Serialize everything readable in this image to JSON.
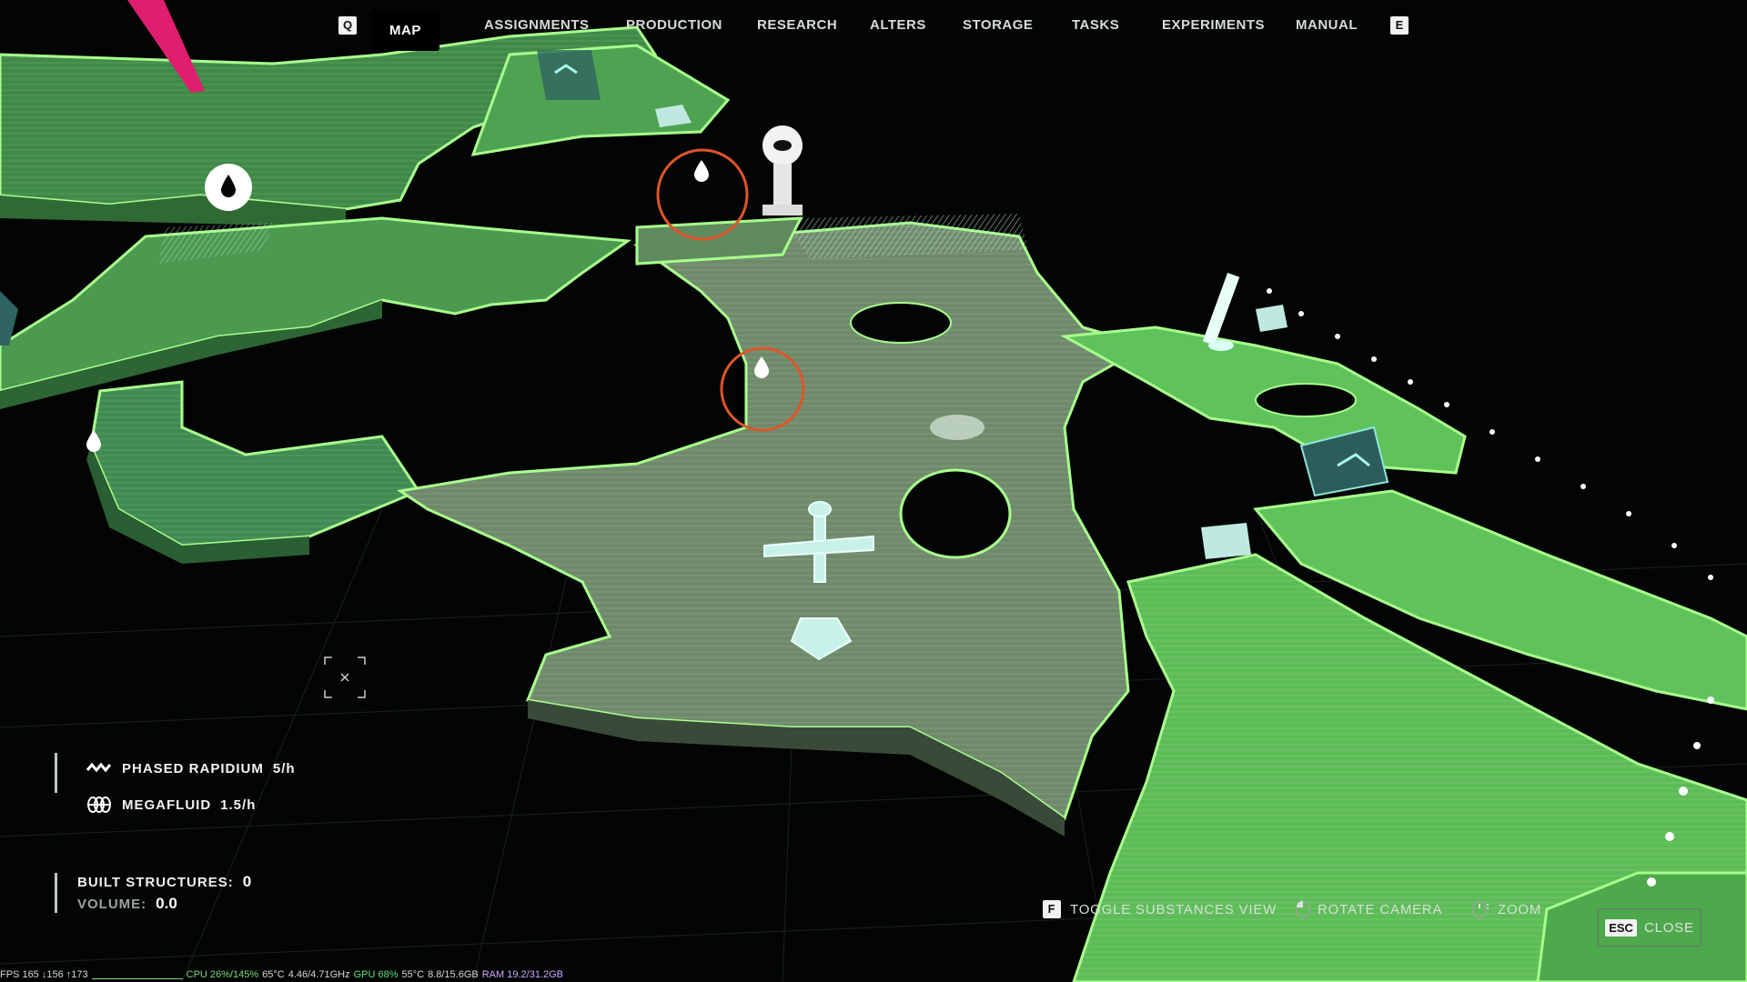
{
  "nav": {
    "left_key": "Q",
    "right_key": "E",
    "tabs": [
      {
        "label": "MAP",
        "active": true
      },
      {
        "label": "ASSIGNMENTS",
        "active": false
      },
      {
        "label": "PRODUCTION",
        "active": false
      },
      {
        "label": "RESEARCH",
        "active": false
      },
      {
        "label": "ALTERS",
        "active": false
      },
      {
        "label": "STORAGE",
        "active": false
      },
      {
        "label": "TASKS",
        "active": false
      },
      {
        "label": "EXPERIMENTS",
        "active": false
      },
      {
        "label": "MANUAL",
        "active": false
      }
    ]
  },
  "resources": [
    {
      "icon": "phased-rapidium-icon",
      "label": "PHASED RAPIDIUM",
      "rate": "5/h"
    },
    {
      "icon": "megafluid-icon",
      "label": "MEGAFLUID",
      "rate": "1.5/h"
    }
  ],
  "structures": {
    "built_label": "BUILT STRUCTURES:",
    "built_value": "0",
    "volume_label": "VOLUME:",
    "volume_value": "0.0"
  },
  "controls": {
    "toggle_key": "F",
    "toggle_label": "TOGGLE SUBSTANCES VIEW",
    "rotate_label": "ROTATE CAMERA",
    "zoom_label": "ZOOM",
    "close_key": "ESC",
    "close_label": "CLOSE"
  },
  "perf": {
    "fps": "FPS 165 ↓156 ↑173",
    "cpu": "CPU 26%/145%",
    "cpu_temp": "65°C",
    "cpu_clock": "4.46/4.71GHz",
    "gpu": "GPU 68%",
    "gpu_temp": "55°C",
    "vram": "8.8/15.6GB",
    "ram": "RAM 19.2/31.2GB"
  },
  "colors": {
    "terrain_bright": "#5fc25a",
    "terrain_mid": "#4e9e52",
    "terrain_grey": "#7f9a7c",
    "outline": "#a8ff8c",
    "marker_ring": "#e0542a",
    "accent_pink": "#e01e6e",
    "background": "#030504"
  },
  "map_markers": [
    {
      "name": "resource-marker-1",
      "icon": "water-drop-icon",
      "highlighted": true
    },
    {
      "name": "resource-marker-2",
      "icon": "water-drop-icon",
      "highlighted": true
    },
    {
      "name": "resource-marker-3",
      "icon": "water-drop-icon",
      "highlighted": false
    },
    {
      "name": "resource-marker-4",
      "icon": "water-drop-icon",
      "highlighted": false
    },
    {
      "name": "player-marker",
      "icon": "player-figure-icon",
      "highlighted": false
    }
  ]
}
